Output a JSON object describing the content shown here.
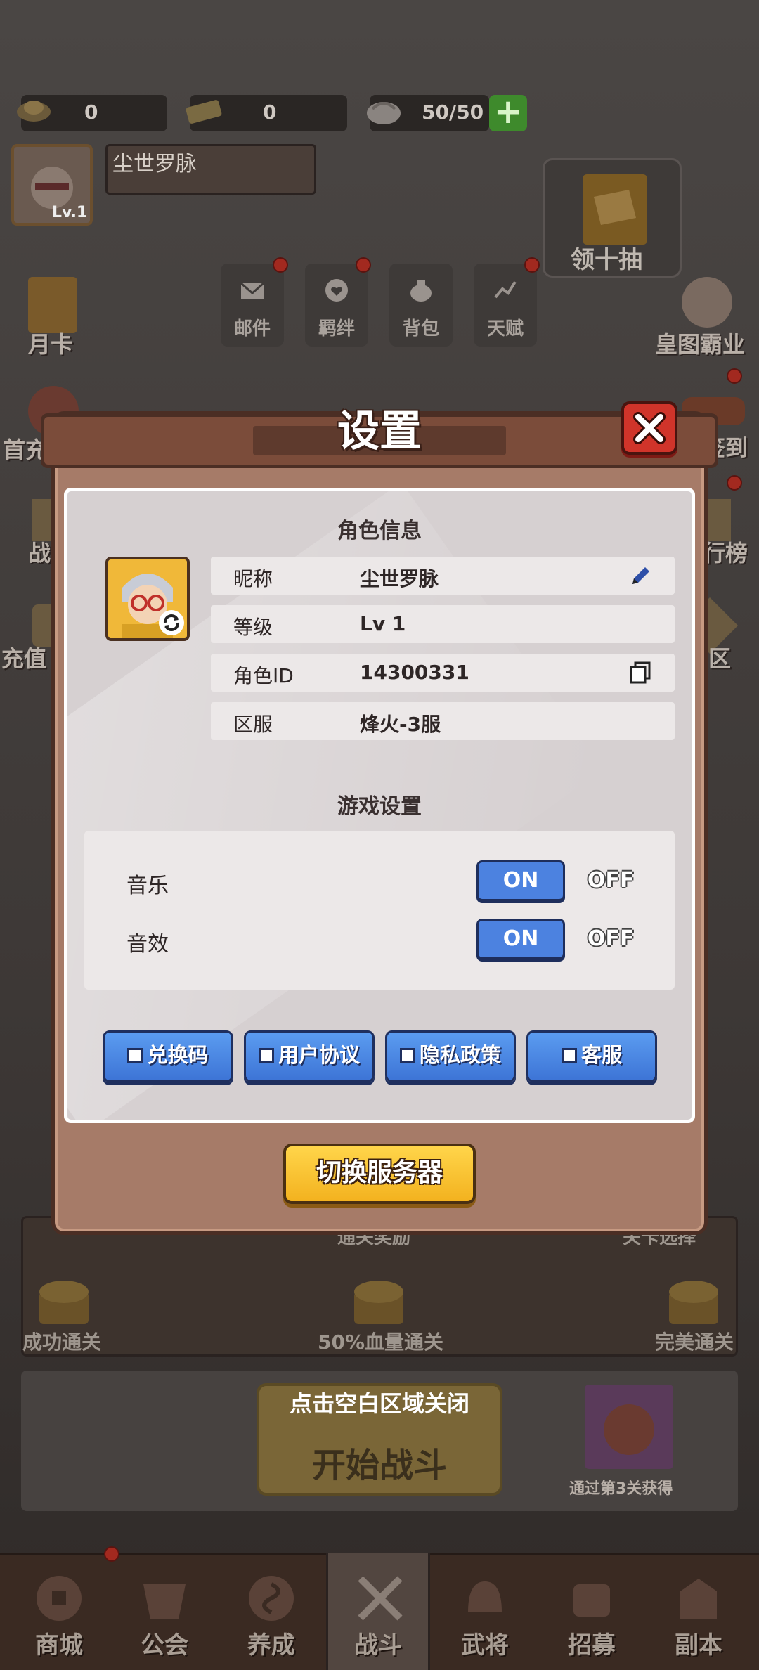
{
  "resources": [
    {
      "icon": "gold-ingot-icon",
      "value": "0"
    },
    {
      "icon": "ticket-icon",
      "value": "0"
    },
    {
      "icon": "bun-stamina-icon",
      "value": "50/50"
    }
  ],
  "player": {
    "name": "尘世罗脉",
    "level_tag": "Lv.1"
  },
  "left_menu": [
    "月卡",
    "首充",
    "战",
    "充值"
  ],
  "right_menu": [
    "皇图霸业",
    "签到",
    "行榜",
    "区"
  ],
  "top_menu": [
    {
      "label": "邮件",
      "icon": "mail-icon"
    },
    {
      "label": "羁绊",
      "icon": "heart-bubble-icon"
    },
    {
      "label": "背包",
      "icon": "bag-icon"
    },
    {
      "label": "天赋",
      "icon": "talent-icon"
    }
  ],
  "gacha_label": "领十抽",
  "stage": {
    "rewards_title": "通关奖励",
    "select_hint": "关卡选择",
    "goals": [
      "成功通关",
      "50%血量通关",
      "完美通关"
    ]
  },
  "battle": {
    "close_hint": "点击空白区域关闭",
    "start_label": "开始战斗",
    "reward_hint": "通过第3关获得"
  },
  "bottom_nav": [
    "商城",
    "公会",
    "养成",
    "战斗",
    "武将",
    "招募",
    "副本"
  ],
  "dialog": {
    "title": "设置",
    "role_section": "角色信息",
    "rows": [
      {
        "key": "昵称",
        "value": "尘世罗脉"
      },
      {
        "key": "等级",
        "value": "Lv 1"
      },
      {
        "key": "角色ID",
        "value": "14300331"
      },
      {
        "key": "区服",
        "value": "烽火-3服"
      }
    ],
    "game_section": "游戏设置",
    "sound_rows": [
      {
        "label": "音乐",
        "on": "ON",
        "off": "OFF"
      },
      {
        "label": "音效",
        "on": "ON",
        "off": "OFF"
      }
    ],
    "buttons": [
      "兑换码",
      "用户协议",
      "隐私政策",
      "客服"
    ],
    "switch_server": "切换服务器"
  },
  "colors": {
    "accent_blue": "#4c82e0",
    "accent_yellow": "#f3b21f",
    "close_red": "#d0342a",
    "dialog_brown": "#a67b68"
  }
}
